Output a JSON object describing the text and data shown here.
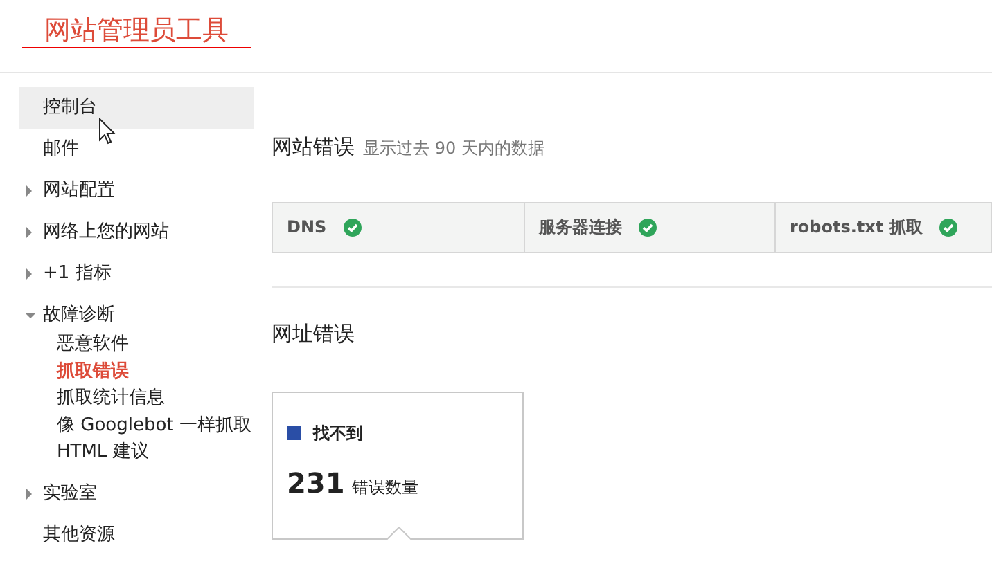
{
  "header": {
    "title": "网站管理员工具"
  },
  "sidebar": {
    "items": [
      {
        "kind": "link",
        "label": "控制台",
        "selected": true
      },
      {
        "kind": "link",
        "label": "邮件",
        "selected": false
      },
      {
        "kind": "folder",
        "label": "网站配置",
        "selected": false,
        "expanded": false
      },
      {
        "kind": "folder",
        "label": "网络上您的网站",
        "selected": false,
        "expanded": false
      },
      {
        "kind": "folder",
        "label": "+1 指标",
        "selected": false,
        "expanded": false
      },
      {
        "kind": "folder",
        "label": "故障诊断",
        "selected": false,
        "expanded": true,
        "children": [
          {
            "label": "恶意软件",
            "selected": false
          },
          {
            "label": "抓取错误",
            "selected": true
          },
          {
            "label": "抓取统计信息",
            "selected": false
          },
          {
            "label": "像 Googlebot 一样抓取",
            "selected": false
          },
          {
            "label": "HTML 建议",
            "selected": false
          }
        ]
      },
      {
        "kind": "folder",
        "label": "实验室",
        "selected": false,
        "expanded": false
      },
      {
        "kind": "link",
        "label": "其他资源",
        "selected": false
      }
    ]
  },
  "site_errors": {
    "title": "网站错误",
    "subtitle": "显示过去 90 天内的数据",
    "columns": [
      {
        "label": "DNS",
        "ok": true
      },
      {
        "label": "服务器连接",
        "ok": true
      },
      {
        "label": "robots.txt 抓取",
        "ok": true
      }
    ]
  },
  "url_errors": {
    "title": "网址错误",
    "cards": [
      {
        "label": "找不到",
        "color": "#2a4ea6",
        "count": "231",
        "count_label": "错误数量",
        "selected": true
      }
    ]
  }
}
